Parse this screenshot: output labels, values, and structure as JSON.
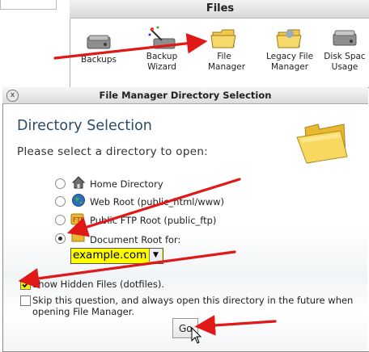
{
  "background_panel": {
    "title": "Files",
    "icons": [
      {
        "name": "backups-icon",
        "label": "Backups"
      },
      {
        "name": "backup-wizard-icon",
        "label": "Backup Wizard"
      },
      {
        "name": "file-manager-icon",
        "label": "File Manager"
      },
      {
        "name": "legacy-file-manager-icon",
        "label": "Legacy File Manager"
      },
      {
        "name": "disk-space-usage-icon",
        "label": "Disk Spac Usage"
      }
    ]
  },
  "dialog": {
    "title": "File Manager Directory Selection",
    "close_label": "x",
    "heading": "Directory Selection",
    "subheading": "Please select a directory to open:",
    "options": [
      {
        "label": "Home Directory",
        "icon": "house-icon",
        "selected": false
      },
      {
        "label": "Web Root (public_html/www)",
        "icon": "globe-icon",
        "selected": false
      },
      {
        "label": "Public FTP Root (public_ftp)",
        "icon": "ftp-icon",
        "selected": false
      },
      {
        "label": "Document Root for:",
        "icon": "folder-icon",
        "selected": true
      }
    ],
    "domain_select": {
      "value": "example.com"
    },
    "show_hidden": {
      "label": "Show Hidden Files (dotfiles).",
      "checked": true
    },
    "skip_question": {
      "label_line1": "Skip this question, and always open this directory in the future when",
      "label_line2": "opening File Manager.",
      "checked": false
    },
    "go_button": "Go"
  },
  "colors": {
    "arrow": "#e01818",
    "select_highlight": "#fffb00",
    "heading": "#2a4a68"
  }
}
